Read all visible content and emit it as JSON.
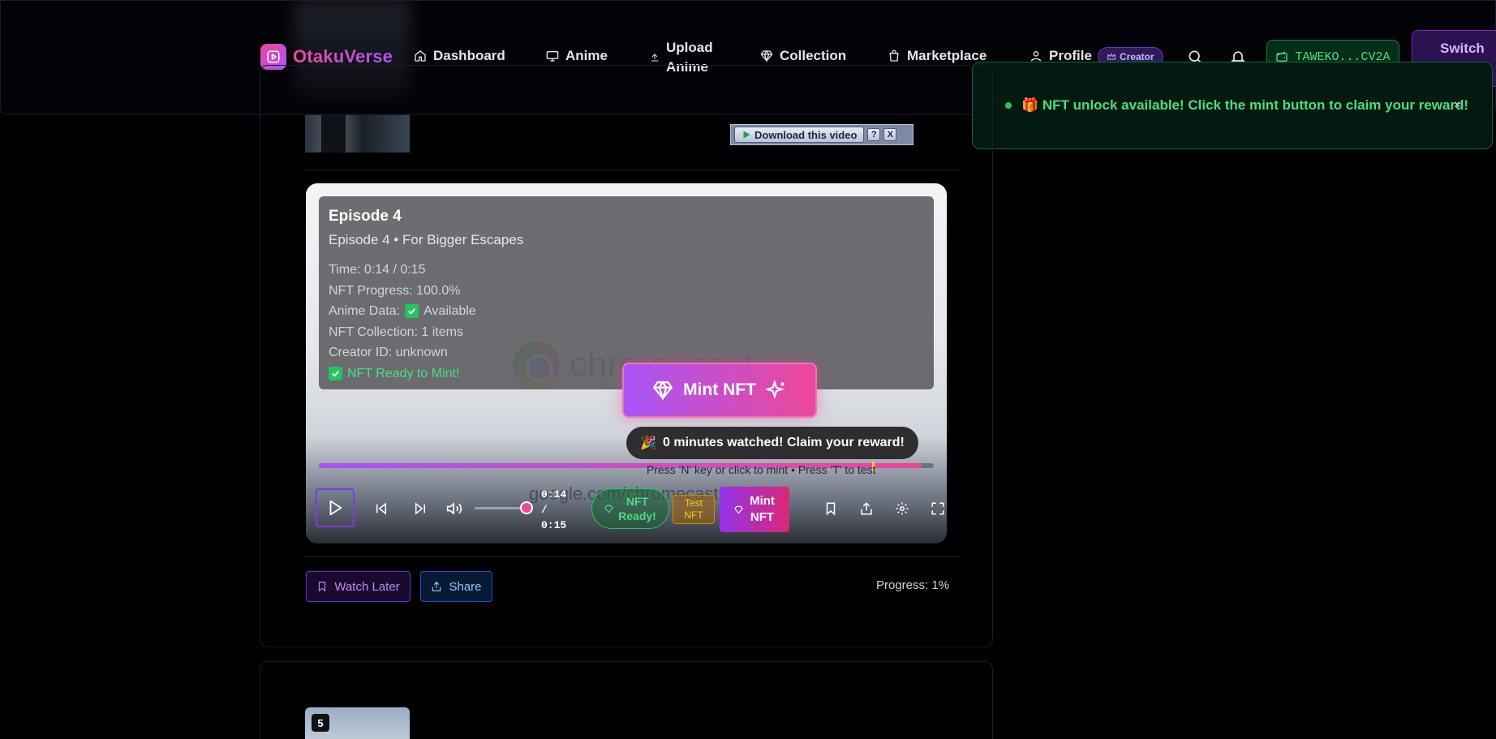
{
  "app": {
    "logo_text": "OtakuVerse"
  },
  "nav": {
    "dashboard": "Dashboard",
    "anime": "Anime",
    "upload_line1": "Upload",
    "upload_line2": "Anime",
    "collection": "Collection",
    "marketplace": "Marketplace",
    "profile": "Profile",
    "creator_badge": "Creator",
    "wallet": "TAWEKO...CV2A",
    "switch": "Switch"
  },
  "toast": {
    "emoji": "🎁",
    "message": "NFT unlock available! Click the mint button to claim your reward!",
    "close": "×"
  },
  "download_bar": {
    "label": "Download this video",
    "help": "?",
    "close": "X"
  },
  "player": {
    "watermark_brand": "chromecast",
    "watermark_url": "google.com/chromecast",
    "info": {
      "title": "Episode 4",
      "subtitle": "Episode 4 • For Bigger Escapes",
      "time": "Time: 0:14 / 0:15",
      "nft_progress": "NFT Progress: 100.0%",
      "anime_data_label": "Anime Data:",
      "anime_data_value": "Available",
      "nft_collection": "NFT Collection: 1 items",
      "creator_id": "Creator ID: unknown",
      "ready": "NFT Ready to Mint!"
    },
    "mint_big_label": "Mint NFT",
    "claim_emoji": "🎉",
    "claim_text": "0 minutes watched! Claim your reward!",
    "press_hint": "Press 'N' key or click to mint • Press 'T' to test",
    "progress_fraction": 0.98,
    "marker_fraction": 0.9,
    "volume_fraction": 0.85,
    "time_current": "0:14",
    "time_sep": "/",
    "time_total": "0:15",
    "nft_ready_line1": "NFT",
    "nft_ready_line2": "Ready!",
    "test_line1": "Test",
    "test_line2": "NFT",
    "mint_small_line1": "Mint",
    "mint_small_line2": "NFT"
  },
  "actions": {
    "watch_later": "Watch Later",
    "share": "Share",
    "progress": "Progress: 1%"
  },
  "next_episode": {
    "number": "5"
  },
  "colors": {
    "accent_purple": "#a855f7",
    "accent_pink": "#ec4899",
    "success_green": "#4ade80"
  }
}
